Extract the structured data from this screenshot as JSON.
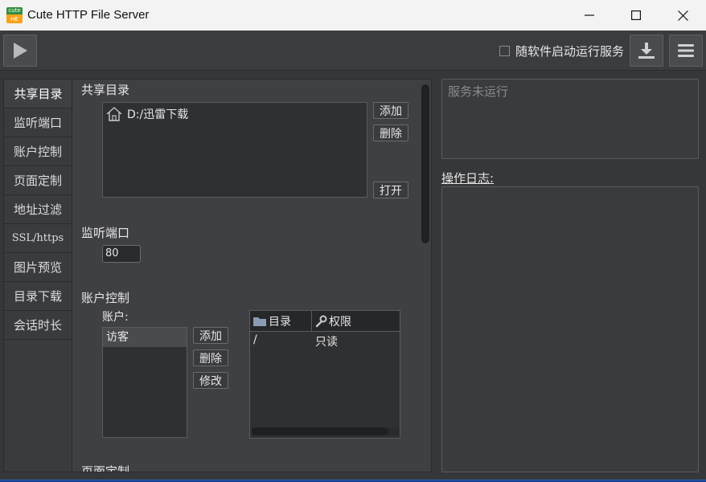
{
  "window": {
    "logo_top": "cute",
    "logo_bottom": "HE",
    "title": "Cute HTTP File Server"
  },
  "toolbar": {
    "autostart_label": "随软件启动运行服务"
  },
  "tabs": [
    {
      "label": "共享目录",
      "active": true
    },
    {
      "label": "监听端口"
    },
    {
      "label": "账户控制"
    },
    {
      "label": "页面定制"
    },
    {
      "label": "地址过滤"
    },
    {
      "label": "SSL/https"
    },
    {
      "label": "图片预览"
    },
    {
      "label": "目录下载"
    },
    {
      "label": "会话时长"
    }
  ],
  "shared": {
    "title": "共享目录",
    "items": [
      "D:/迅雷下载"
    ],
    "add": "添加",
    "delete": "删除",
    "open": "打开"
  },
  "port": {
    "title": "监听端口",
    "value": "80"
  },
  "accounts": {
    "title": "账户控制",
    "account_label": "账户:",
    "items": [
      "访客"
    ],
    "add": "添加",
    "delete": "删除",
    "edit": "修改",
    "col_dir": "目录",
    "col_perm": "权限",
    "rows": [
      {
        "dir": "/",
        "perm": "只读"
      }
    ]
  },
  "page_custom": {
    "title": "页面定制"
  },
  "status": {
    "text": "服务未运行"
  },
  "log": {
    "label": "操作日志:"
  }
}
